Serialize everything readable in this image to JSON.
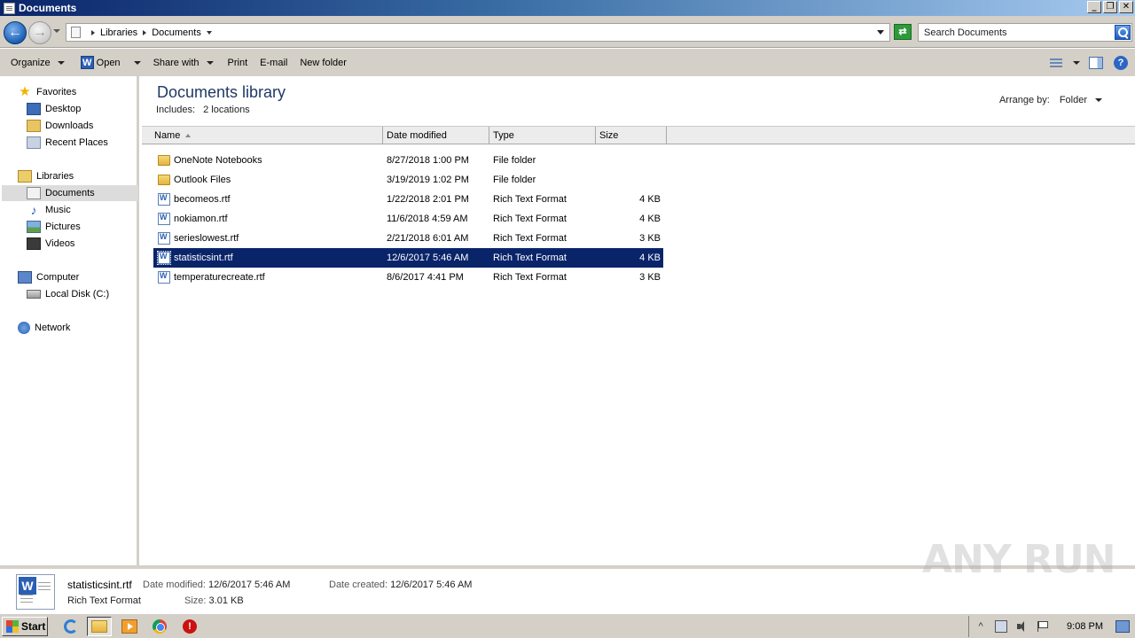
{
  "window": {
    "title": "Documents",
    "controls": [
      "_",
      "❐",
      "✕"
    ]
  },
  "address": {
    "crumbs": [
      "Libraries",
      "Documents"
    ],
    "search_placeholder": "Search Documents"
  },
  "commands": {
    "organize": "Organize",
    "open": "Open",
    "share_with": "Share with",
    "print": "Print",
    "email": "E-mail",
    "new_folder": "New folder"
  },
  "nav": {
    "favorites": "Favorites",
    "desktop": "Desktop",
    "downloads": "Downloads",
    "recent_places": "Recent Places",
    "libraries": "Libraries",
    "documents": "Documents",
    "music": "Music",
    "pictures": "Pictures",
    "videos": "Videos",
    "computer": "Computer",
    "local_disk": "Local Disk (C:)",
    "network": "Network"
  },
  "library": {
    "title": "Documents library",
    "includes_label": "Includes:",
    "includes_value": "2 locations",
    "arrange_label": "Arrange by:",
    "arrange_value": "Folder"
  },
  "columns": {
    "name": "Name",
    "date": "Date modified",
    "type": "Type",
    "size": "Size"
  },
  "files": [
    {
      "name": "OneNote Notebooks",
      "date": "8/27/2018 1:00 PM",
      "type": "File folder",
      "size": "",
      "icon": "folder-icon"
    },
    {
      "name": "Outlook Files",
      "date": "3/19/2019 1:02 PM",
      "type": "File folder",
      "size": "",
      "icon": "folder-icon"
    },
    {
      "name": "becomeos.rtf",
      "date": "1/22/2018 2:01 PM",
      "type": "Rich Text Format",
      "size": "4 KB",
      "icon": "rtf-file-icon"
    },
    {
      "name": "nokiamon.rtf",
      "date": "11/6/2018 4:59 AM",
      "type": "Rich Text Format",
      "size": "4 KB",
      "icon": "rtf-file-icon"
    },
    {
      "name": "serieslowest.rtf",
      "date": "2/21/2018 6:01 AM",
      "type": "Rich Text Format",
      "size": "3 KB",
      "icon": "rtf-file-icon"
    },
    {
      "name": "statisticsint.rtf",
      "date": "12/6/2017 5:46 AM",
      "type": "Rich Text Format",
      "size": "4 KB",
      "icon": "rtf-file-icon",
      "selected": true
    },
    {
      "name": "temperaturecreate.rtf",
      "date": "8/6/2017 4:41 PM",
      "type": "Rich Text Format",
      "size": "3 KB",
      "icon": "rtf-file-icon"
    }
  ],
  "details": {
    "name": "statisticsint.rtf",
    "type": "Rich Text Format",
    "modified_label": "Date modified:",
    "modified_value": "12/6/2017 5:46 AM",
    "created_label": "Date created:",
    "created_value": "12/6/2017 5:46 AM",
    "size_label": "Size:",
    "size_value": "3.01 KB"
  },
  "watermark": "ANY RUN",
  "taskbar": {
    "start": "Start",
    "clock": "9:08 PM",
    "tray_expand": "^"
  }
}
